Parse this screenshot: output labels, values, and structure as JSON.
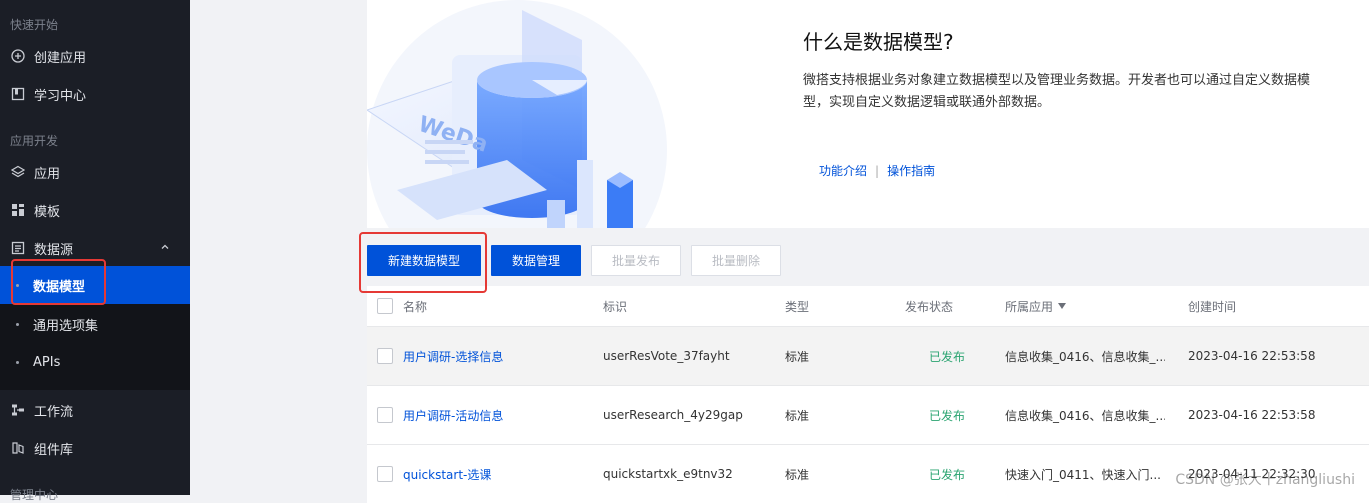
{
  "sidebar": {
    "section_quickstart": "快速开始",
    "create_app": "创建应用",
    "learning_center": "学习中心",
    "section_dev": "应用开发",
    "apps": "应用",
    "templates": "模板",
    "datasource": "数据源",
    "sub_items": [
      "数据模型",
      "通用选项集",
      "APIs"
    ],
    "workflow": "工作流",
    "components": "组件库",
    "section_manage": "管理中心"
  },
  "banner": {
    "title": "什么是数据模型?",
    "description": "微搭支持根据业务对象建立数据模型以及管理业务数据。开发者也可以通过自定义数据模型，实现自定义数据逻辑或联通外部数据。",
    "link_intro": "功能介绍",
    "link_sep": "|",
    "link_guide": "操作指南",
    "illustration_text": "WeDa"
  },
  "toolbar": {
    "new_model": "新建数据模型",
    "data_manage": "数据管理",
    "batch_publish": "批量发布",
    "batch_delete": "批量删除"
  },
  "table": {
    "headers": [
      "名称",
      "标识",
      "类型",
      "发布状态",
      "所属应用",
      "创建时间"
    ],
    "rows": [
      {
        "name": "用户调研-选择信息",
        "id": "userResVote_37fayht",
        "type": "标准",
        "status": "已发布",
        "app": "信息收集_0416、信息收集_...",
        "created": "2023-04-16 22:53:58"
      },
      {
        "name": "用户调研-活动信息",
        "id": "userResearch_4y29gap",
        "type": "标准",
        "status": "已发布",
        "app": "信息收集_0416、信息收集_...",
        "created": "2023-04-16 22:53:58"
      },
      {
        "name": "quickstart-选课",
        "id": "quickstartxk_e9tnv32",
        "type": "标准",
        "status": "已发布",
        "app": "快速入门_0411、快速入门...",
        "created": "2023-04-11 22:32:30"
      }
    ]
  },
  "watermark": "CSDN @张大十zhangliushi",
  "colors": {
    "primary": "#0052d9",
    "sidebar_bg": "#1b1e26",
    "success": "#2ba471",
    "highlight_box": "#e53935"
  }
}
